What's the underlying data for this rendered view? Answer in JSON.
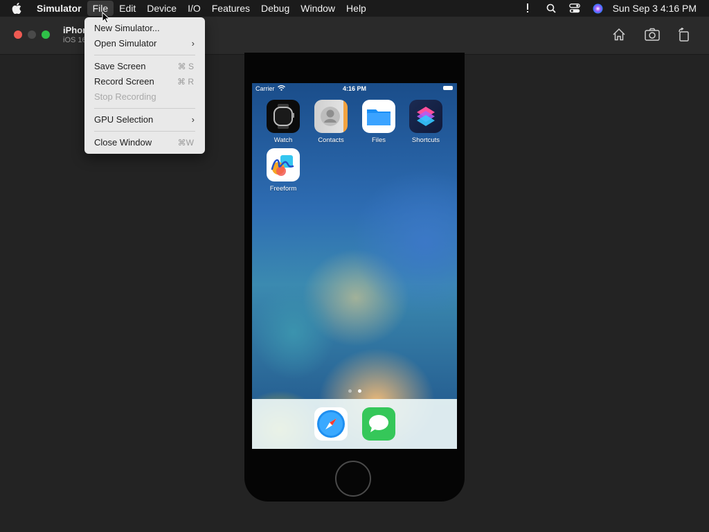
{
  "menubar": {
    "app_name": "Simulator",
    "menus": [
      "File",
      "Edit",
      "Device",
      "I/O",
      "Features",
      "Debug",
      "Window",
      "Help"
    ],
    "active_menu": "File",
    "clock": "Sun Sep 3  4:16 PM",
    "icons": [
      "apple-icon",
      "exclamation-icon",
      "search-icon",
      "control-center-icon",
      "siri-icon"
    ]
  },
  "toolbar": {
    "device_title": "iPhone",
    "device_subtitle": "iOS 16",
    "buttons": [
      "home-icon",
      "screenshot-icon",
      "rotate-icon"
    ]
  },
  "file_menu": {
    "items": [
      {
        "label": "New Simulator...",
        "shortcut": "",
        "submenu": false,
        "enabled": true
      },
      {
        "label": "Open Simulator",
        "shortcut": "",
        "submenu": true,
        "enabled": true
      },
      {
        "label": "Save Screen",
        "shortcut": "⌘ S",
        "submenu": false,
        "enabled": true
      },
      {
        "label": "Record Screen",
        "shortcut": "⌘ R",
        "submenu": false,
        "enabled": true
      },
      {
        "label": "Stop Recording",
        "shortcut": "",
        "submenu": false,
        "enabled": false
      },
      {
        "label": "GPU Selection",
        "shortcut": "",
        "submenu": true,
        "enabled": true
      },
      {
        "label": "Close Window",
        "shortcut": "⌘W",
        "submenu": false,
        "enabled": true
      }
    ]
  },
  "phone": {
    "status": {
      "carrier": "Carrier",
      "time": "4:16 PM"
    },
    "apps": [
      "Watch",
      "Contacts",
      "Files",
      "Shortcuts",
      "Freeform"
    ],
    "dock": [
      "Safari",
      "Messages"
    ],
    "page_count": 2,
    "current_page": 2
  }
}
